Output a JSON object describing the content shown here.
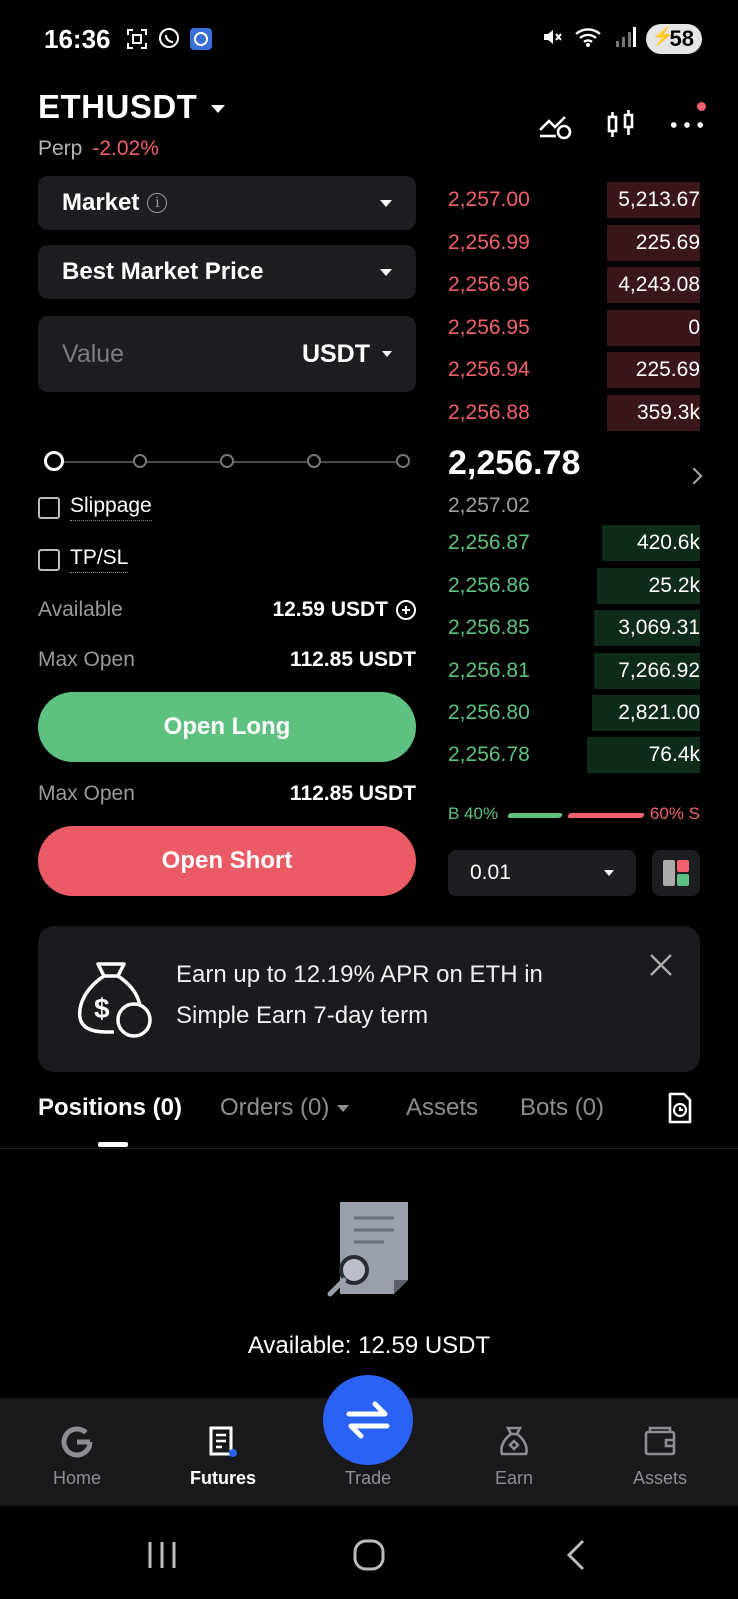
{
  "status_bar": {
    "time": "16:36",
    "battery": "58"
  },
  "header": {
    "pair": "ETHUSDT",
    "type": "Perp",
    "change": "-2.02%"
  },
  "form": {
    "order_type": "Market",
    "price_mode": "Best Market Price",
    "value_placeholder": "Value",
    "value_unit": "USDT",
    "slippage_label": "Slippage",
    "tpsl_label": "TP/SL",
    "available_label": "Available",
    "available_value": "12.59 USDT",
    "max_open_label": "Max Open",
    "max_open_long": "112.85 USDT",
    "max_open_short": "112.85 USDT",
    "open_long": "Open Long",
    "open_short": "Open Short"
  },
  "order_book": {
    "asks": [
      {
        "price": "2,257.00",
        "qty": "5,213.67",
        "depth": 0.37
      },
      {
        "price": "2,256.99",
        "qty": "225.69",
        "depth": 0.37
      },
      {
        "price": "2,256.96",
        "qty": "4,243.08",
        "depth": 0.37
      },
      {
        "price": "2,256.95",
        "qty": "0",
        "depth": 0.37
      },
      {
        "price": "2,256.94",
        "qty": "225.69",
        "depth": 0.37
      },
      {
        "price": "2,256.88",
        "qty": "359.3k",
        "depth": 0.37
      }
    ],
    "last_price": "2,256.78",
    "mark_price": "2,257.02",
    "bids": [
      {
        "price": "2,256.87",
        "qty": "420.6k",
        "depth": 0.39
      },
      {
        "price": "2,256.86",
        "qty": "25.2k",
        "depth": 0.41
      },
      {
        "price": "2,256.85",
        "qty": "3,069.31",
        "depth": 0.42
      },
      {
        "price": "2,256.81",
        "qty": "7,266.92",
        "depth": 0.42
      },
      {
        "price": "2,256.80",
        "qty": "2,821.00",
        "depth": 0.43
      },
      {
        "price": "2,256.78",
        "qty": "76.4k",
        "depth": 0.45
      }
    ],
    "buy_ratio": "B 40%",
    "sell_ratio": "60% S",
    "precision": "0.01"
  },
  "promo": {
    "line1": "Earn up to 12.19% APR on ETH in",
    "line2": "Simple Earn 7-day term"
  },
  "tabs": {
    "positions": "Positions (0)",
    "orders": "Orders (0)",
    "assets": "Assets",
    "bots": "Bots (0)"
  },
  "empty": {
    "available": "Available: 12.59 USDT"
  },
  "bottom_nav": {
    "home": "Home",
    "futures": "Futures",
    "trade": "Trade",
    "earn": "Earn",
    "assets": "Assets"
  },
  "colors": {
    "green": "#5ec182",
    "red": "#ea5b65",
    "accent": "#2a63f3"
  }
}
